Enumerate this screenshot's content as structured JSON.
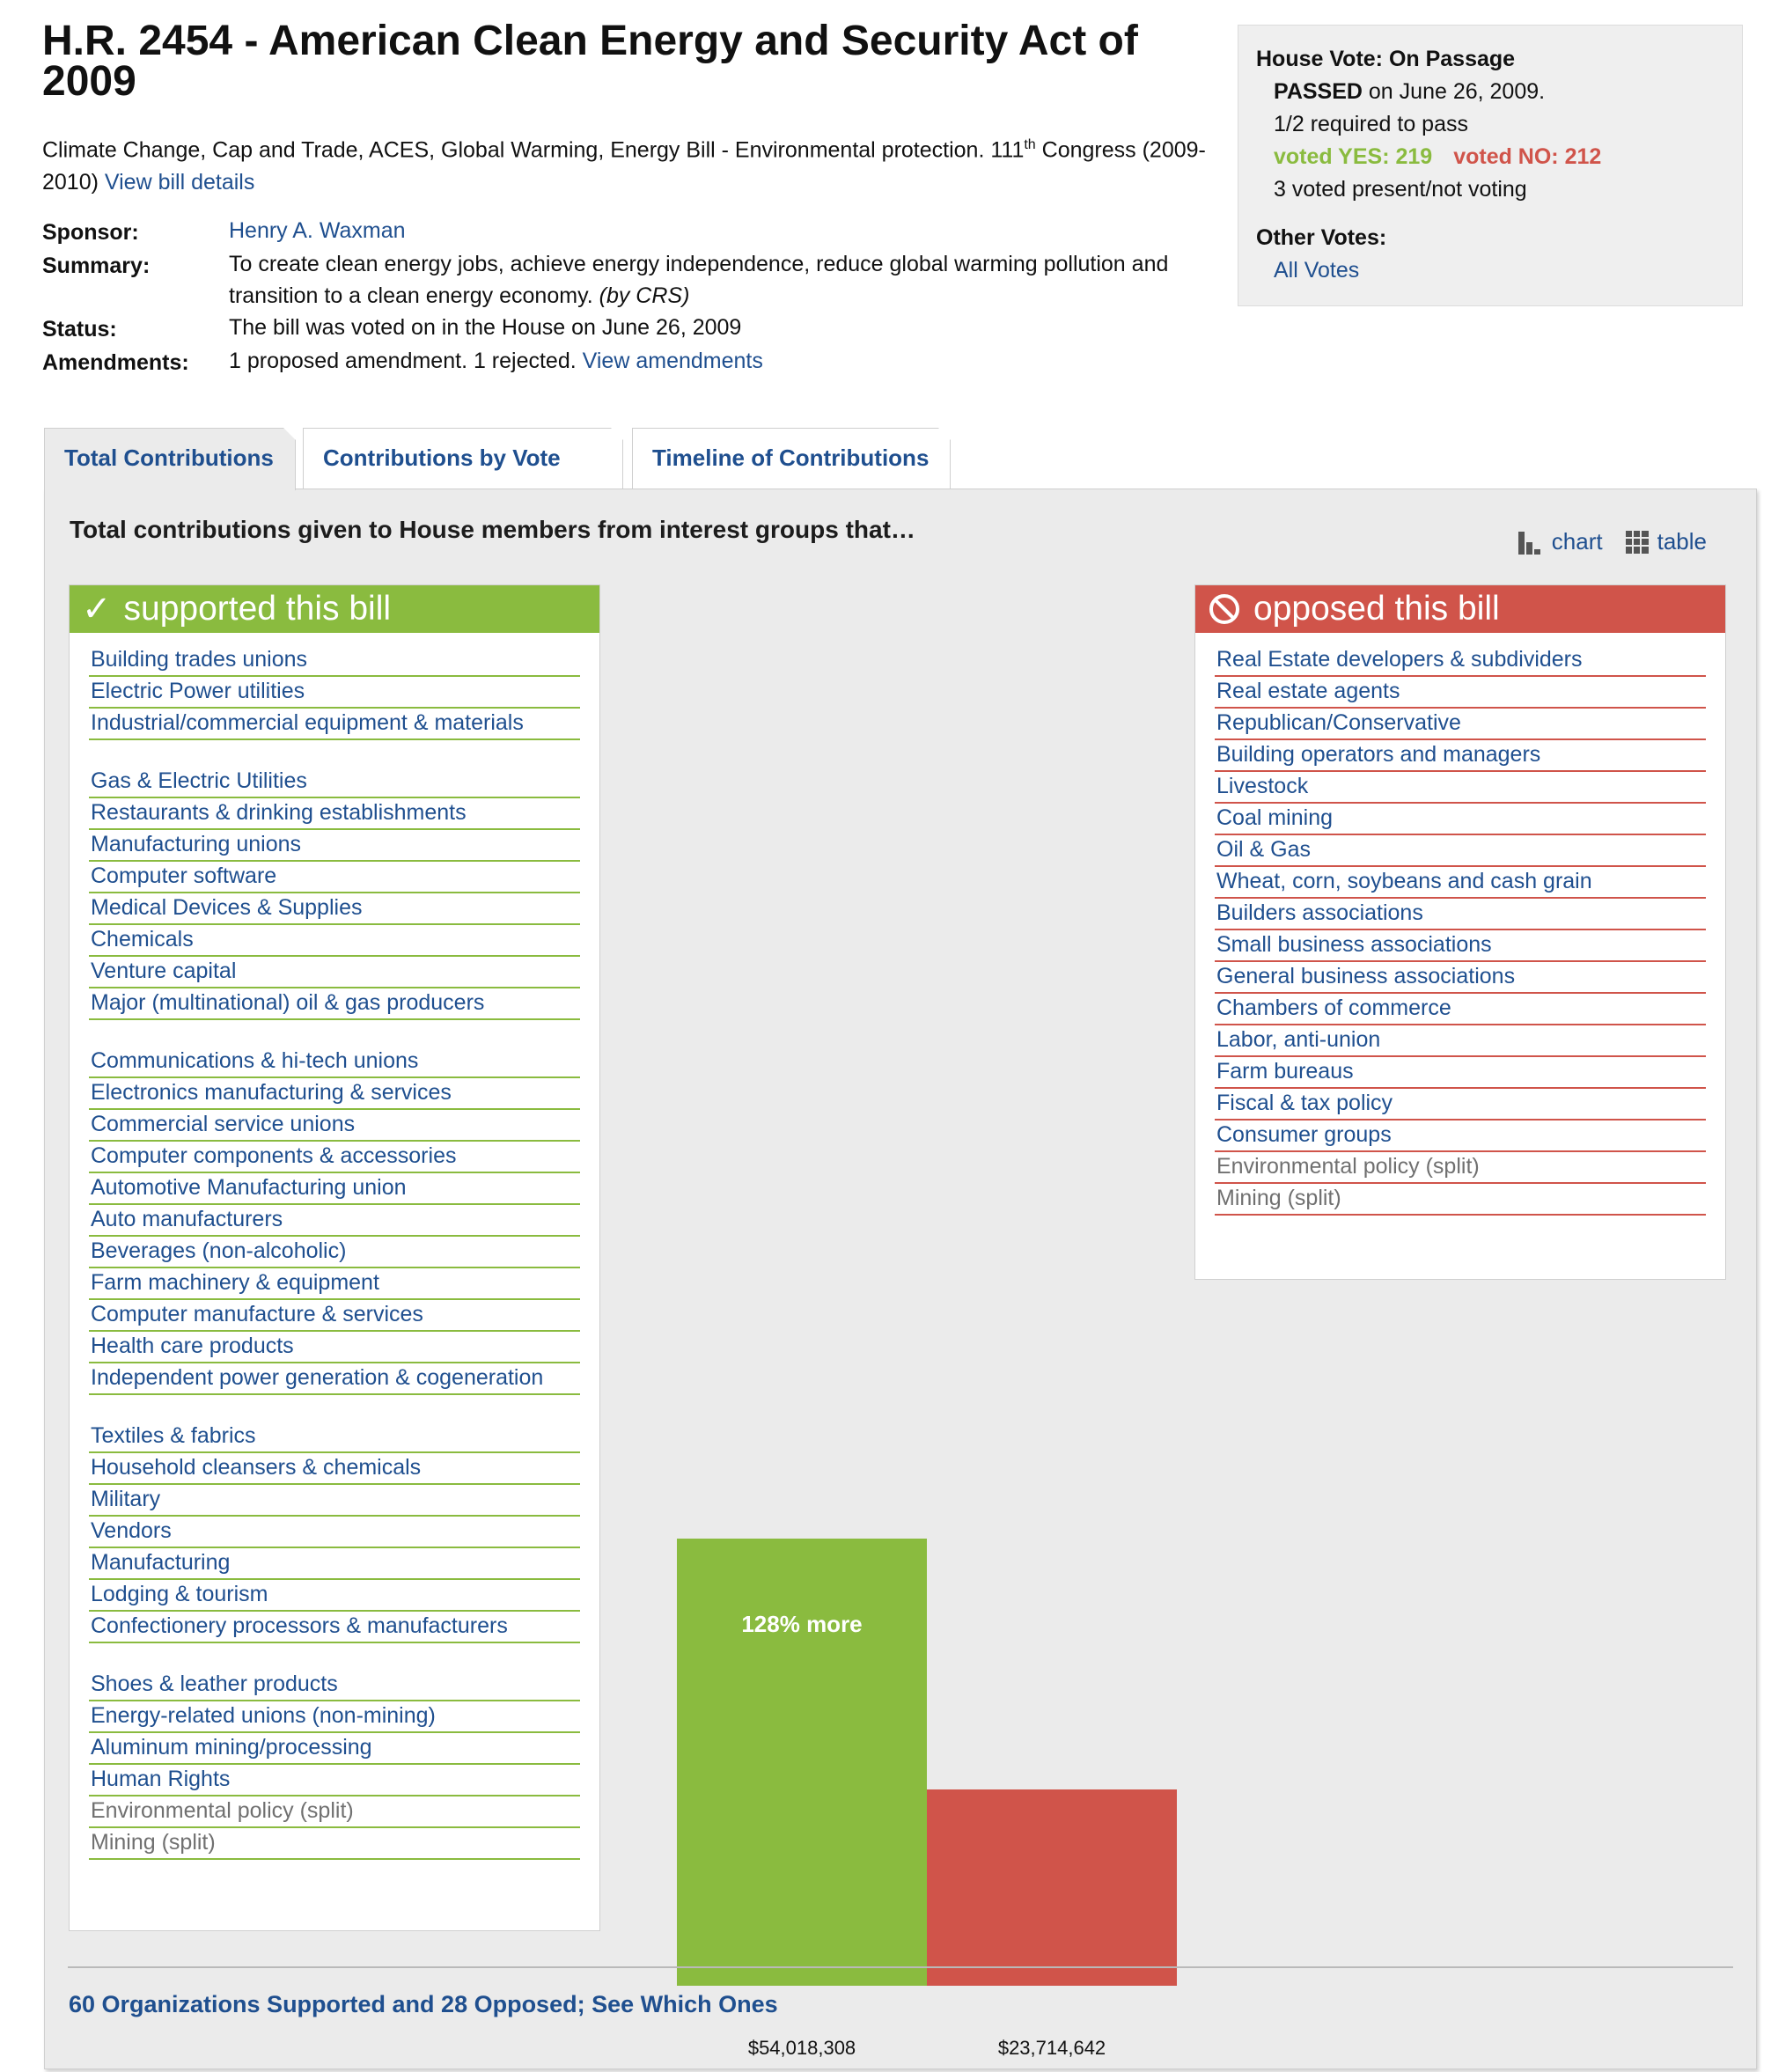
{
  "bill": {
    "title": "H.R. 2454 - American Clean Energy and Security Act of 2009",
    "subtitle_text": "Climate Change, Cap and Trade, ACES, Global Warming, Energy Bill - Environmental protection. 111",
    "subtitle_sup": "th",
    "subtitle_congress": "Congress (2009-2010)",
    "details_link": "View bill details",
    "sponsor_label": "Sponsor:",
    "sponsor": "Henry A. Waxman",
    "summary_label": "Summary:",
    "summary": "To create clean energy jobs, achieve energy independence, reduce global warming pollution and transition to a clean energy economy.",
    "summary_source": "(by CRS)",
    "status_label": "Status:",
    "status": "The bill was voted on in the House on June 26, 2009",
    "amendments_label": "Amendments:",
    "amendments": "1 proposed amendment. 1 rejected.",
    "amendments_link": "View amendments"
  },
  "vote": {
    "title": "House Vote: On Passage",
    "result": "PASSED",
    "result_date": "on June 26, 2009.",
    "required": "1/2 required to pass",
    "yes": "voted YES: 219",
    "no": "voted NO: 212",
    "other": "3 voted present/not voting",
    "other_votes_label": "Other Votes:",
    "all_votes_link": "All Votes"
  },
  "tabs": [
    "Total Contributions",
    "Contributions by Vote",
    "Timeline of Contributions"
  ],
  "panel": {
    "heading": "Total contributions given to House members from interest groups that…",
    "chart_toggle": "chart",
    "table_toggle": "table",
    "supported_header": "supported this bill",
    "opposed_header": "opposed this bill",
    "footer_link": "60 Organizations Supported and 28 Opposed; See Which Ones"
  },
  "supported": [
    {
      "name": "Building trades unions"
    },
    {
      "name": "Electric Power utilities"
    },
    {
      "name": "Industrial/commercial equipment & materials"
    },
    {
      "name": "Gas & Electric Utilities",
      "gap": true
    },
    {
      "name": "Restaurants & drinking establishments"
    },
    {
      "name": "Manufacturing unions"
    },
    {
      "name": "Computer software"
    },
    {
      "name": "Medical Devices & Supplies"
    },
    {
      "name": "Chemicals"
    },
    {
      "name": "Venture capital"
    },
    {
      "name": "Major (multinational) oil & gas producers"
    },
    {
      "name": "Communications & hi-tech unions",
      "gap": true
    },
    {
      "name": "Electronics manufacturing & services"
    },
    {
      "name": "Commercial service unions"
    },
    {
      "name": "Computer components & accessories"
    },
    {
      "name": "Automotive Manufacturing union"
    },
    {
      "name": "Auto manufacturers"
    },
    {
      "name": "Beverages (non-alcoholic)"
    },
    {
      "name": "Farm machinery & equipment"
    },
    {
      "name": "Computer manufacture & services"
    },
    {
      "name": "Health care products"
    },
    {
      "name": "Independent power generation & cogeneration"
    },
    {
      "name": "Textiles & fabrics",
      "gap": true
    },
    {
      "name": "Household cleansers & chemicals"
    },
    {
      "name": "Military"
    },
    {
      "name": "Vendors"
    },
    {
      "name": "Manufacturing"
    },
    {
      "name": "Lodging & tourism"
    },
    {
      "name": "Confectionery processors & manufacturers"
    },
    {
      "name": "Shoes & leather products",
      "gap": true
    },
    {
      "name": "Energy-related unions (non-mining)"
    },
    {
      "name": "Aluminum mining/processing"
    },
    {
      "name": "Human Rights"
    },
    {
      "name": "Environmental policy (split)",
      "split": true
    },
    {
      "name": "Mining (split)",
      "split": true
    }
  ],
  "opposed": [
    {
      "name": "Real Estate developers & subdividers"
    },
    {
      "name": "Real estate agents"
    },
    {
      "name": "Republican/Conservative"
    },
    {
      "name": "Building operators and managers"
    },
    {
      "name": "Livestock"
    },
    {
      "name": "Coal mining"
    },
    {
      "name": "Oil & Gas"
    },
    {
      "name": "Wheat, corn, soybeans and cash grain"
    },
    {
      "name": "Builders associations"
    },
    {
      "name": "Small business associations"
    },
    {
      "name": "General business associations"
    },
    {
      "name": "Chambers of commerce"
    },
    {
      "name": "Labor, anti-union"
    },
    {
      "name": "Farm bureaus"
    },
    {
      "name": "Fiscal & tax policy"
    },
    {
      "name": "Consumer groups"
    },
    {
      "name": "Environmental policy (split)",
      "split": true
    },
    {
      "name": "Mining (split)",
      "split": true
    }
  ],
  "chart_data": {
    "type": "bar",
    "categories": [
      "supported this bill",
      "opposed this bill"
    ],
    "values": [
      54018308,
      23714642
    ],
    "value_labels": [
      "$54,018,308",
      "$23,714,642"
    ],
    "annotation": "128% more",
    "colors": [
      "#8abb3f",
      "#d0544a"
    ]
  },
  "colors": {
    "support": "#8abb3f",
    "oppose": "#d0544a",
    "link": "#1f4f8f"
  }
}
